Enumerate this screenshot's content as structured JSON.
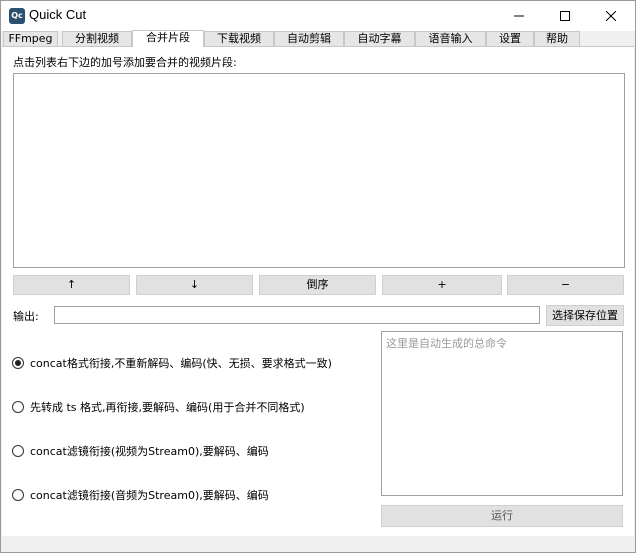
{
  "window": {
    "title": "Quick Cut",
    "icon_text": "Qc",
    "controls": [
      "minimize-icon",
      "maximize-icon",
      "close-icon"
    ]
  },
  "tabs": [
    {
      "label": "FFmpeg",
      "active": false
    },
    {
      "label": "分割视频",
      "active": false
    },
    {
      "label": "合并片段",
      "active": true
    },
    {
      "label": "下载视频",
      "active": false
    },
    {
      "label": "自动剪辑",
      "active": false
    },
    {
      "label": "自动字幕",
      "active": false
    },
    {
      "label": "语音输入",
      "active": false
    },
    {
      "label": "设置",
      "active": false
    },
    {
      "label": "帮助",
      "active": false
    }
  ],
  "merge": {
    "hint": "点击列表右下边的加号添加要合并的视频片段:",
    "buttons": {
      "up": "↑",
      "down": "↓",
      "reverse": "倒序",
      "add": "+",
      "remove": "−"
    },
    "output_label": "输出:",
    "output_value": "",
    "choose_location": "选择保存位置",
    "options": [
      {
        "label": "concat格式衔接,不重新解码、编码(快、无损、要求格式一致)",
        "checked": true
      },
      {
        "label": "先转成 ts 格式,再衔接,要解码、编码(用于合并不同格式)",
        "checked": false
      },
      {
        "label": "concat滤镜衔接(视频为Stream0),要解码、编码",
        "checked": false
      },
      {
        "label": "concat滤镜衔接(音频为Stream0),要解码、编码",
        "checked": false
      }
    ],
    "command_placeholder": "这里是自动生成的总命令",
    "run": "运行"
  }
}
